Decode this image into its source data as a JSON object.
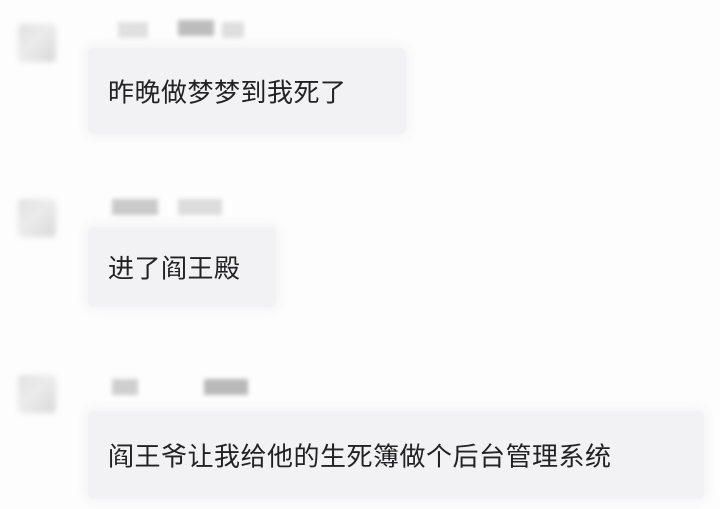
{
  "chat": {
    "messages": [
      {
        "sender": "",
        "text": "昨晚做梦梦到我死了"
      },
      {
        "sender": "",
        "text": "进了阎王殿"
      },
      {
        "sender": "",
        "text": "阎王爷让我给他的生死簿做个后台管理系统"
      }
    ]
  },
  "colors": {
    "background": "#fdfdfd",
    "bubble": "#f2f2f4",
    "text": "#222222",
    "blur": "#c8c8c8"
  }
}
